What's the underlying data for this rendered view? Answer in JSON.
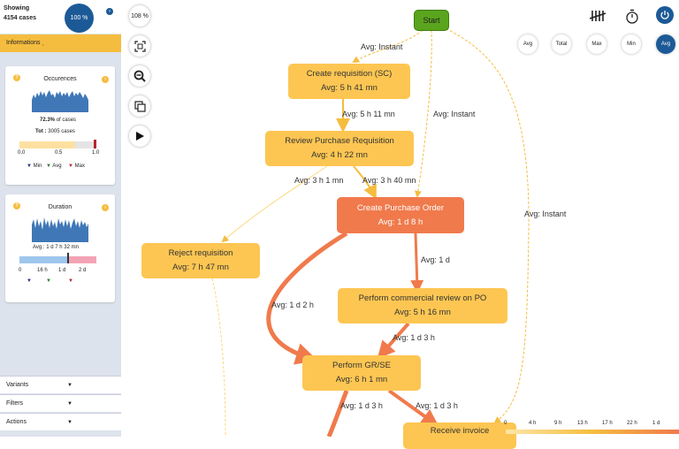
{
  "sidebar": {
    "showing_label": "Showing",
    "cases_count": "4154 cases",
    "percent": "100 %",
    "informations_label": "Informations",
    "occurences": {
      "title": "Occurences",
      "percent_value": "72.3%",
      "percent_suffix": "of cases",
      "total_label": "Tot :",
      "total_value": "3005 cases",
      "axis": [
        "0.0",
        "0.5",
        "1.0"
      ],
      "fill_fraction": 0.723,
      "legend": [
        "Min",
        "Avg",
        "Max"
      ]
    },
    "duration": {
      "title": "Duration",
      "avg_label": "Avg :",
      "avg_value": "1 d 7 h 32 mn",
      "axis": [
        "0",
        "16 h",
        "1 d",
        "2 d"
      ]
    },
    "bottom_items": [
      "Variants",
      "Filters",
      "Actions"
    ]
  },
  "toolbar": {
    "zoom": "108 %",
    "icons": [
      "fit-screen-icon",
      "zoom-out-icon",
      "copy-icon",
      "play-icon"
    ]
  },
  "right_toolbar": {
    "icons": [
      "tally-icon",
      "stopwatch-icon",
      "power-icon"
    ],
    "metrics": [
      "Avg",
      "Total",
      "Max",
      "Min",
      "Avg"
    ],
    "active_metric": 4
  },
  "graph": {
    "nodes": [
      {
        "id": "start",
        "name": "Start",
        "avg": ""
      },
      {
        "id": "create_req",
        "name": "Create requisition (SC)",
        "avg": "Avg: 5 h 41 mn"
      },
      {
        "id": "review_req",
        "name": "Review Purchase Requisition",
        "avg": "Avg: 4 h 22 mn"
      },
      {
        "id": "create_po",
        "name": "Create Purchase Order",
        "avg": "Avg: 1 d 8 h"
      },
      {
        "id": "reject_req",
        "name": "Reject requisition",
        "avg": "Avg: 7 h 47 mn"
      },
      {
        "id": "commercial_review",
        "name": "Perform commercial review on PO",
        "avg": "Avg: 5 h 16 mn"
      },
      {
        "id": "gr_se",
        "name": "Perform GR/SE",
        "avg": "Avg: 6 h 1 mn"
      },
      {
        "id": "receive_invoice",
        "name": "Receive invoice",
        "avg": ""
      }
    ],
    "edge_labels": [
      "Avg: Instant",
      "Avg: 5 h 11 mn",
      "Avg: Instant",
      "Avg: 3 h 1 mn",
      "Avg: 3 h 40 mn",
      "Avg: Instant",
      "Avg: 1 d",
      "Avg: 1 d 2 h",
      "Avg: 1 d 3 h",
      "Avg: 1 d 3 h",
      "Avg: 1 d 3 h"
    ]
  },
  "legend": {
    "ticks": [
      "0",
      "4 h",
      "9 h",
      "13 h",
      "17 h",
      "22 h",
      "1 d"
    ],
    "colors": [
      "#fde6a8",
      "#f5bd3f",
      "#f07a4c"
    ]
  }
}
